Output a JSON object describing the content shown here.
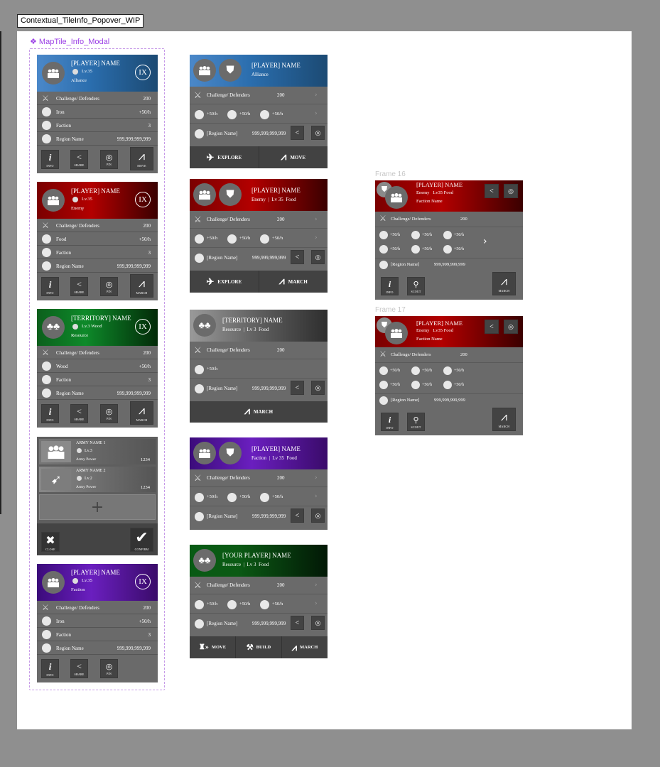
{
  "page_title": "Contextual_TileInfo_Popover_WIP",
  "component_label": "❖ MapTile_Info_Modal",
  "frames": {
    "frame16": "Frame 16",
    "frame17": "Frame 17"
  },
  "left": {
    "c1": {
      "name": "[PLAYER] NAME",
      "level": "Lv.35",
      "relation": "Alliance",
      "badge": "IX",
      "rows": [
        {
          "label": "Challenge/ Defenders",
          "value": "200"
        },
        {
          "label": "Iron",
          "value": "+50/h"
        },
        {
          "label": "Faction",
          "value": "3"
        },
        {
          "label": "Region Name",
          "value": "999,999,999,999"
        }
      ],
      "buttons": [
        "INFO",
        "SHARE",
        "PIN",
        "MOVE"
      ]
    },
    "c2": {
      "name": "[PLAYER] NAME",
      "level": "Lv.35",
      "relation": "Enemy",
      "badge": "IX",
      "rows": [
        {
          "label": "Challenge/ Defenders",
          "value": "200"
        },
        {
          "label": "Food",
          "value": "+50/h"
        },
        {
          "label": "Faction",
          "value": "3"
        },
        {
          "label": "Region Name",
          "value": "999,999,999,999"
        }
      ],
      "buttons": [
        "INFO",
        "SHARE",
        "PIN",
        "MARCH"
      ]
    },
    "c3": {
      "name": "[TERRITORY] NAME",
      "level": "Lv.3 Wood",
      "relation": "Resource",
      "badge": "IX",
      "rows": [
        {
          "label": "Challenge/ Defenders",
          "value": "200"
        },
        {
          "label": "Wood",
          "value": "+50/h"
        },
        {
          "label": "Faction",
          "value": "3"
        },
        {
          "label": "Region Name",
          "value": "999,999,999,999"
        }
      ],
      "buttons": [
        "INFO",
        "SHARE",
        "PIN",
        "MARCH"
      ]
    },
    "c4": {
      "armies": [
        {
          "name": "ARMY NAME 1",
          "level": "Lv.3",
          "power_label": "Army Power",
          "power": "1234"
        },
        {
          "name": "ARMY NAME 2",
          "level": "Lv.2",
          "power_label": "Army Power",
          "power": "1234"
        }
      ],
      "add": "+",
      "close": "CLOSE",
      "confirm": "CONFIRM"
    },
    "c5": {
      "name": "[PLAYER] NAME",
      "level": "Lv.35",
      "relation": "Faction",
      "badge": "IX",
      "rows": [
        {
          "label": "Challenge/ Defenders",
          "value": "200"
        },
        {
          "label": "Iron",
          "value": "+50/h"
        },
        {
          "label": "Faction",
          "value": "3"
        },
        {
          "label": "Region Name",
          "value": "999,999,999,999"
        }
      ],
      "buttons": [
        "INFO",
        "SHARE",
        "PIN"
      ]
    }
  },
  "mid": {
    "m1": {
      "name": "[PLAYER] NAME",
      "sub": "Alliance",
      "cd": "Challenge/ Defenders",
      "cdv": "200",
      "res": [
        "+50/h",
        "+50/h",
        "+50/h"
      ],
      "region": "[Region Name]",
      "rv": "999,999,999,999",
      "actions": [
        "EXPLORE",
        "MOVE"
      ]
    },
    "m2": {
      "name": "[PLAYER] NAME",
      "sub": "Enemy  |  Lv 35  Food",
      "cd": "Challenge/ Defenders",
      "cdv": "200",
      "res": [
        "+50/h",
        "+50/h",
        "+50/h"
      ],
      "region": "[Region Name]",
      "rv": "999,999,999,999",
      "actions": [
        "EXPLORE",
        "MARCH"
      ]
    },
    "m3": {
      "name": "[TERRITORY] NAME",
      "sub": "Resource  |  Lv 3  Food",
      "cd": "Challenge/ Defenders",
      "cdv": "200",
      "res": [
        "+50/h"
      ],
      "region": "[Region Name]",
      "rv": "999,999,999,999",
      "actions": [
        "MARCH"
      ]
    },
    "m4": {
      "name": "[PLAYER] NAME",
      "sub": "Faction  |  Lv 35  Food",
      "cd": "Challenge/ Defenders",
      "cdv": "200",
      "res": [
        "+50/h",
        "+50/h",
        "+50/h"
      ],
      "region": "[Region Name]",
      "rv": "999,999,999,999"
    },
    "m5": {
      "name": "[YOUR PLAYER] NAME",
      "sub": "Resource  |  Lv 3  Food",
      "cd": "Challenge/ Defenders",
      "cdv": "200",
      "res": [
        "+50/h",
        "+50/h",
        "+50/h"
      ],
      "region": "[Region Name]",
      "rv": "999,999,999,999",
      "actions": [
        "MOVE",
        "BUILD",
        "MARCH"
      ]
    }
  },
  "right": {
    "r1": {
      "name": "[PLAYER] NAME",
      "sub": "Enemy   Lv35 Food",
      "faction": "Faction Name",
      "cd": "Challenge/ Defenders",
      "cdv": "200",
      "res": [
        "+50/h",
        "+50/h",
        "+50/h",
        "+50/h",
        "+50/h",
        "+50/h"
      ],
      "region": "[Region Name]",
      "rv": "999,999,999,999",
      "buttons": [
        "INFO",
        "SCOUT",
        "MARCH"
      ]
    },
    "r2": {
      "name": "[PLAYER] NAME",
      "sub": "Enemy   Lv35 Food",
      "faction": "Faction Name",
      "cd": "Challenge/ Defenders",
      "cdv": "200",
      "res": [
        "+50/h",
        "+50/h",
        "+50/h",
        "+50/h",
        "+50/h",
        "+50/h"
      ],
      "region": "[Region Name]",
      "rv": "999,999,999,999",
      "buttons": [
        "INFO",
        "SCOUT",
        "MARCH"
      ]
    }
  },
  "colors": {
    "alliance": "#2a6dad",
    "enemy": "#b30000",
    "resource": "#0e8a2a",
    "faction": "#6a1fbf",
    "panel": "#6a6a6a",
    "button": "#434343"
  }
}
